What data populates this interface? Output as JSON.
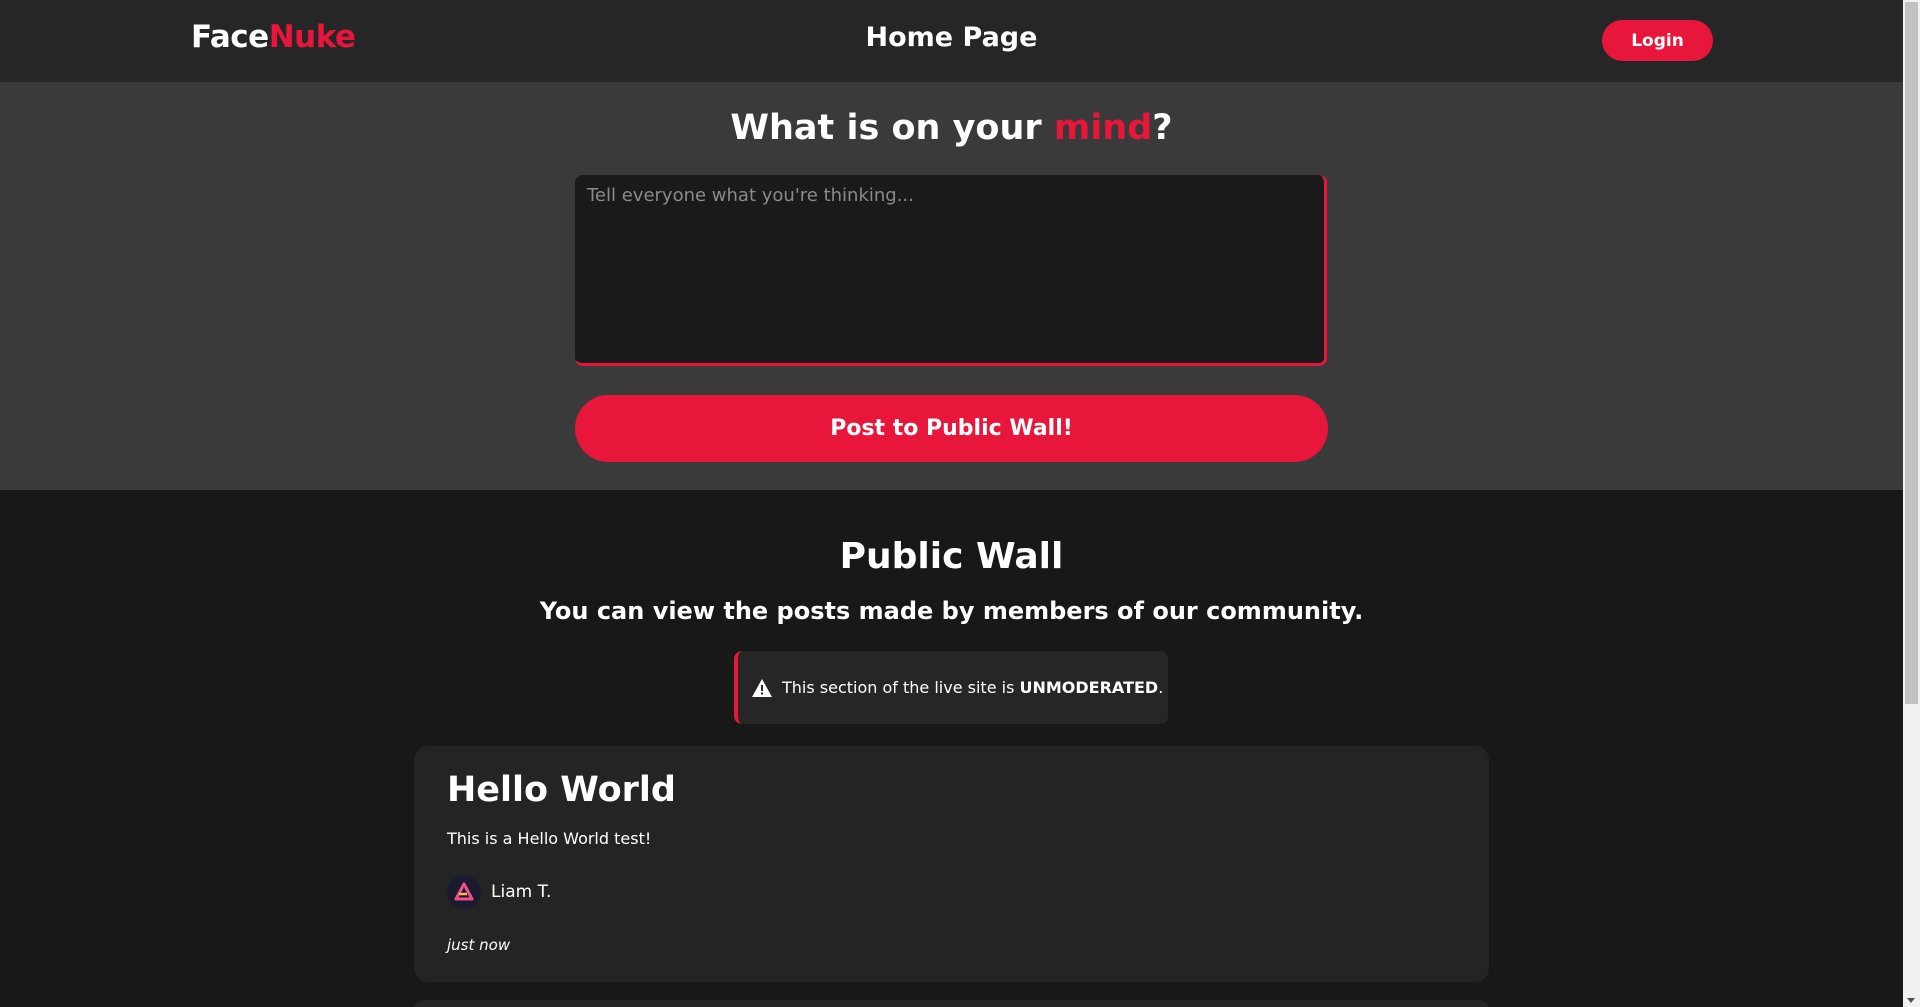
{
  "header": {
    "logo_part1": "Face",
    "logo_part2": "Nuke",
    "title": "Home Page",
    "login_label": "Login"
  },
  "compose": {
    "heading_part1": "What is on your ",
    "heading_accent": "mind",
    "heading_part2": "?",
    "placeholder": "Tell everyone what you're thinking...",
    "post_button_label": "Post to Public Wall!"
  },
  "wall": {
    "title": "Public Wall",
    "subtitle": "You can view the posts made by members of our community.",
    "warning_prefix": "This section of the live site is ",
    "warning_emphasis": "UNMODERATED",
    "warning_suffix": ".",
    "warning_icon": "warning-triangle-icon"
  },
  "posts": [
    {
      "title": "Hello World",
      "body": "This is a Hello World test!",
      "author": "Liam T.",
      "avatar_icon": "avatar-logo-icon",
      "time": "just now"
    }
  ],
  "colors": {
    "accent": "#e9163b",
    "header_bg": "#262627",
    "compose_bg": "#3a3a3b",
    "page_bg": "#181819"
  }
}
